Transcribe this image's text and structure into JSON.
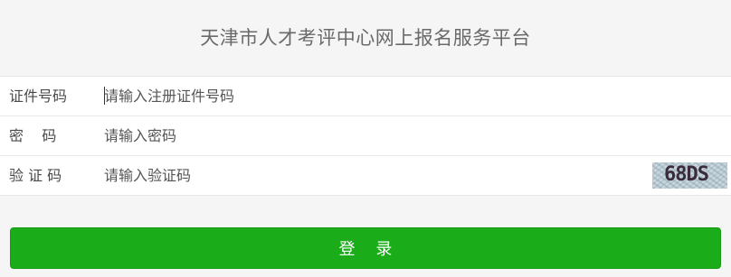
{
  "header": {
    "title": "天津市人才考评中心网上报名服务平台"
  },
  "form": {
    "id_number": {
      "label": "证件号码",
      "placeholder": "请输入注册证件号码",
      "value": ""
    },
    "password": {
      "label": "密    码",
      "placeholder": "请输入密码",
      "value": ""
    },
    "captcha": {
      "label": "验 证 码",
      "placeholder": "请输入验证码",
      "value": "",
      "image_text": "68DS"
    }
  },
  "actions": {
    "login_label": "登    录"
  },
  "colors": {
    "accent": "#1aad19",
    "background": "#f5f5f5"
  }
}
